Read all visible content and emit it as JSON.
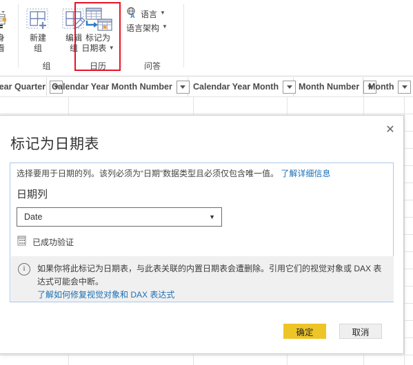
{
  "ribbon": {
    "cut_button": {
      "line1": "身",
      "line2": "看",
      "icon": "table-view-icon"
    },
    "groups": [
      {
        "name": "group-group",
        "label": "组",
        "buttons": [
          {
            "name": "new-group",
            "line1": "新建",
            "line2": "组",
            "icon": "new-group-icon"
          },
          {
            "name": "edit-group",
            "line1": "编辑",
            "line2": "组",
            "icon": "edit-group-icon"
          }
        ]
      },
      {
        "name": "calendar-group",
        "label": "日历",
        "highlighted": true,
        "buttons": [
          {
            "name": "mark-as-date-table",
            "line1": "标记为",
            "line2": "日期表",
            "icon": "mark-as-date-table-icon",
            "has_dropdown": true
          }
        ]
      },
      {
        "name": "qna-group",
        "label": "问答",
        "small_buttons": [
          {
            "name": "language",
            "label": "语言",
            "icon": "globe-language-icon",
            "has_dropdown": true
          },
          {
            "name": "linguistic-schema",
            "label": "语言架构",
            "icon": "none",
            "has_dropdown": true
          }
        ]
      }
    ]
  },
  "column_headers": [
    {
      "name": "col-calendar-year-quarter",
      "label": "ar Year Quarter",
      "filter": "filter-dropdown-icon"
    },
    {
      "name": "col-calendar-year-month-number",
      "label": "Calendar Year Month Number",
      "filter": "filter-dropdown-icon"
    },
    {
      "name": "col-calendar-year-month",
      "label": "Calendar Year Month",
      "filter": "filter-dropdown-icon"
    },
    {
      "name": "col-month-number",
      "label": "Month Number",
      "filter": "filter-dropdown-icon"
    },
    {
      "name": "col-month",
      "label": "Month",
      "filter": "filter-dropdown-icon"
    }
  ],
  "dialog": {
    "title": "标记为日期表",
    "close_label": "✕",
    "description": "选择要用于日期的列。该列必须为“日期”数据类型且必须仅包含唯一值。",
    "description_link": "了解详细信息",
    "field_label": "日期列",
    "select": {
      "value": "Date",
      "arrow": "▼",
      "options": [
        "Date"
      ]
    },
    "validation": {
      "icon": "date-table-icon",
      "text": "已成功验证"
    },
    "warning": {
      "icon": "info-icon",
      "icon_glyph": "i",
      "text": "如果你将此标记为日期表，与此表关联的内置日期表会遭删除。引用它们的视觉对象或 DAX 表达式可能会中断。",
      "link": "了解如何修复视觉对象和 DAX 表达式"
    },
    "buttons": {
      "ok": "确定",
      "cancel": "取消"
    }
  },
  "colors": {
    "accent_ok": "#eec527",
    "highlight_box": "#e81123",
    "link": "#1a6fb5",
    "body_border": "#a9c8e8",
    "warning_bg": "#f0f0f0"
  }
}
